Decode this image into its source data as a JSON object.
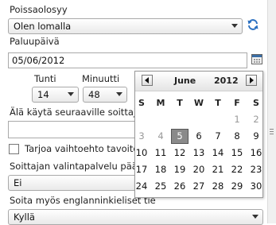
{
  "absence_type": {
    "label": "Poissaolosyy",
    "value": "Olen lomalla"
  },
  "return_date": {
    "label": "Paluupäivä",
    "value": "05/06/2012"
  },
  "hours": {
    "label": "Tunti",
    "value": "14"
  },
  "minutes": {
    "label": "Minuutti",
    "value": "48"
  },
  "dont_use_label": "Älä käytä seuraaville soittajille",
  "offer_alternative_label": "Tarjoa vaihtoehto tavoitella",
  "caller_service_label": "Soittajan valintapalvelu päälle",
  "caller_service_value": "Ei",
  "english_label": "Soita myös englanninkieliset tie",
  "english_value": "Kyllä",
  "datepicker": {
    "month": "June",
    "year": "2012",
    "weekdays": [
      "S",
      "M",
      "T",
      "W",
      "T",
      "F",
      "S"
    ],
    "weeks": [
      [
        {
          "d": "",
          "m": false
        },
        {
          "d": "",
          "m": false
        },
        {
          "d": "",
          "m": false
        },
        {
          "d": "",
          "m": false
        },
        {
          "d": "",
          "m": false
        },
        {
          "d": "1",
          "m": true
        },
        {
          "d": "2",
          "m": true
        }
      ],
      [
        {
          "d": "3",
          "m": true
        },
        {
          "d": "4",
          "m": true
        },
        {
          "d": "5",
          "m": false,
          "today": true
        },
        {
          "d": "6",
          "m": false
        },
        {
          "d": "7",
          "m": false
        },
        {
          "d": "8",
          "m": false
        },
        {
          "d": "9",
          "m": false
        }
      ],
      [
        {
          "d": "10",
          "m": false
        },
        {
          "d": "11",
          "m": false
        },
        {
          "d": "12",
          "m": false
        },
        {
          "d": "13",
          "m": false
        },
        {
          "d": "14",
          "m": false
        },
        {
          "d": "15",
          "m": false
        },
        {
          "d": "16",
          "m": false
        }
      ],
      [
        {
          "d": "17",
          "m": false
        },
        {
          "d": "18",
          "m": false
        },
        {
          "d": "19",
          "m": false
        },
        {
          "d": "20",
          "m": false
        },
        {
          "d": "21",
          "m": false
        },
        {
          "d": "22",
          "m": false
        },
        {
          "d": "23",
          "m": false
        }
      ],
      [
        {
          "d": "24",
          "m": false
        },
        {
          "d": "25",
          "m": false
        },
        {
          "d": "26",
          "m": false
        },
        {
          "d": "27",
          "m": false
        },
        {
          "d": "28",
          "m": false
        },
        {
          "d": "29",
          "m": false
        },
        {
          "d": "30",
          "m": false
        }
      ]
    ]
  },
  "icons": {
    "refresh": "refresh-icon",
    "calendar": "calendar-icon"
  },
  "colors": {
    "refresh": "#2a6fc0",
    "today_bg": "#8a8a8a"
  }
}
